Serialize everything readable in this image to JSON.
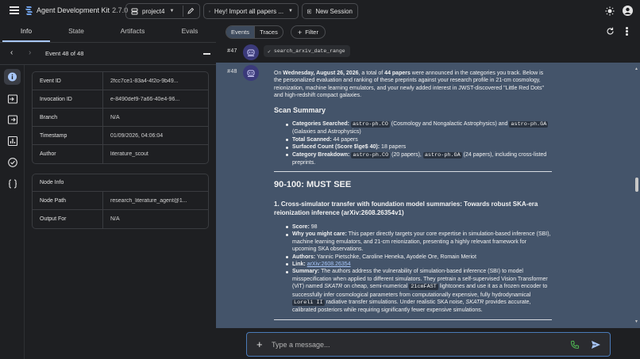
{
  "app": {
    "title": "Agent Development Kit",
    "version": "2.7.0"
  },
  "topbar": {
    "project": "project4",
    "session": "Hey! Import all papers ...",
    "new_session": "New Session"
  },
  "left_panel": {
    "tabs": [
      "Info",
      "State",
      "Artifacts",
      "Evals"
    ],
    "active_tab": "Info",
    "event_nav": "Event 48 of 48",
    "event_info": [
      {
        "key": "Event ID",
        "value": "2fcc7ce1-83a4-4f2o-9b49..."
      },
      {
        "key": "Invocation ID",
        "value": "e-8490def9-7a66-40e4-96..."
      },
      {
        "key": "Branch",
        "value": "N/A"
      },
      {
        "key": "Timestamp",
        "value": "01/09/2026, 04:06:04"
      },
      {
        "key": "Author",
        "value": "literature_scout"
      }
    ],
    "node_info_title": "Node Info",
    "node_info": [
      {
        "key": "Node Path",
        "value": "research_literature_agent@1..."
      },
      {
        "key": "Output For",
        "value": "N/A"
      }
    ]
  },
  "right_toolbar": {
    "events": "Events",
    "traces": "Traces",
    "filter": "Filter"
  },
  "events": {
    "e47": {
      "num": "#47",
      "tool": "search_arxiv_date_range"
    },
    "e48": {
      "num": "#48",
      "intro_1": "On ",
      "intro_date": "Wednesday, August 26, 2026",
      "intro_2": ", a total of ",
      "intro_count": "44 papers",
      "intro_3": " were announced in the categories you track. Below is the personalized evaluation and ranking of these preprints against your research profile in 21-cm cosmology, reionization, machine learning emulators, and your newly added interest in JWST-discovered \"Little Red Dots\" and high-redshift compact galaxies.",
      "scan_title": "Scan Summary",
      "cat_label": "Categories Searched:",
      "cat_code1": "astro-ph.CO",
      "cat_text1": "(Cosmology and Nongalactic Astrophysics) and",
      "cat_code2": "astro-ph.GA",
      "cat_text2": "(Galaxies and Astrophysics)",
      "total_label": "Total Scanned:",
      "total_value": "44 papers",
      "surf_label": "Surfaced Count (Score $\\ge$ 40):",
      "surf_value": "18 papers",
      "break_label": "Category Breakdown:",
      "break_code1": "astro-ph.CO",
      "break_text1": "(20 papers),",
      "break_code2": "astro-ph.GA",
      "break_text2": "(24 papers), including cross-listed preprints.",
      "must_see": "90-100: MUST SEE",
      "paper_title": "1. Cross-simulator transfer with foundation model summaries: Towards robust SKA-era reionization inference (arXiv:2608.26354v1)",
      "score_label": "Score:",
      "score_value": "98",
      "why_label": "Why you might care:",
      "why_text": "This paper directly targets your core expertise in simulation-based inference (SBI), machine learning emulators, and 21-cm reionization, presenting a highly relevant framework for upcoming SKA observations.",
      "authors_label": "Authors:",
      "authors_value": "Yannic Pietschke, Caroline Heneka, Ayodele Ore, Romain Meriot",
      "link_label": "Link:",
      "link_value": "arXiv:2608.26354",
      "summary_label": "Summary:",
      "summary_1": "The authors address the vulnerability of simulation-based inference (SBI) to model misspecification when applied to different simulators. They pretrain a self-supervised Vision Transformer (ViT) named ",
      "summary_skatr": "SKATR",
      "summary_2": " on cheap, semi-numerical ",
      "summary_code1": "21cmFAST",
      "summary_3": " lightcones and use it as a frozen encoder to successfully infer cosmological parameters from computationally expensive, fully hydrodynamical ",
      "summary_code2": "Loreli II",
      "summary_4": " radiative transfer simulations. Under realistic SKA noise, ",
      "summary_skatr2": "SKATR",
      "summary_5": " provides accurate, calibrated posteriors while requiring significantly fewer expensive simulations."
    }
  },
  "input": {
    "placeholder": "Type a message..."
  },
  "colors": {
    "accent": "#a8c7fa",
    "event_bg": "#44546a",
    "avatar": "#3b3a7a",
    "phone": "#4caf50"
  }
}
